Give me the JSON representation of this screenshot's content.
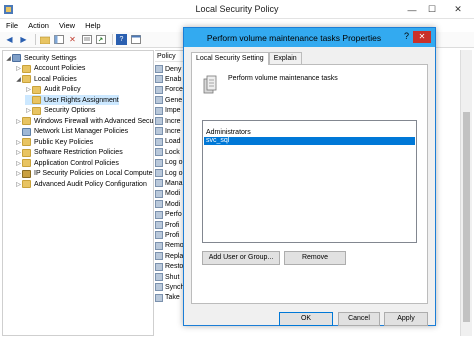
{
  "window": {
    "title": "Local Security Policy"
  },
  "menubar": {
    "items": [
      "File",
      "Action",
      "View",
      "Help"
    ]
  },
  "toolbar": {
    "buttons": [
      "back-icon",
      "forward-icon",
      "up-folder-icon",
      "show-hide-tree-icon",
      "delete-icon",
      "properties-icon",
      "export-icon",
      "help-icon",
      "console-icon"
    ]
  },
  "tree": {
    "items": [
      {
        "label": "Security Settings",
        "level": 0,
        "expander": "◢",
        "icon": "shield"
      },
      {
        "label": "Account Policies",
        "level": 1,
        "expander": "▷",
        "icon": "folder"
      },
      {
        "label": "Local Policies",
        "level": 1,
        "expander": "◢",
        "icon": "folder"
      },
      {
        "label": "Audit Policy",
        "level": 2,
        "expander": "▷",
        "icon": "folder"
      },
      {
        "label": "User Rights Assignment",
        "level": 2,
        "expander": "",
        "icon": "folder",
        "selected": true
      },
      {
        "label": "Security Options",
        "level": 2,
        "expander": "▷",
        "icon": "folder"
      },
      {
        "label": "Windows Firewall with Advanced Secu",
        "level": 1,
        "expander": "▷",
        "icon": "folder"
      },
      {
        "label": "Network List Manager Policies",
        "level": 1,
        "expander": "",
        "icon": "net"
      },
      {
        "label": "Public Key Policies",
        "level": 1,
        "expander": "▷",
        "icon": "folder"
      },
      {
        "label": "Software Restriction Policies",
        "level": 1,
        "expander": "▷",
        "icon": "folder"
      },
      {
        "label": "Application Control Policies",
        "level": 1,
        "expander": "▷",
        "icon": "folder"
      },
      {
        "label": "IP Security Policies on Local Compute",
        "level": 1,
        "expander": "▷",
        "icon": "ipsec"
      },
      {
        "label": "Advanced Audit Policy Configuration",
        "level": 1,
        "expander": "▷",
        "icon": "folder"
      }
    ]
  },
  "policy_column": {
    "header": "Policy",
    "rows": [
      "Deny",
      "Enab",
      "Force",
      "Gene",
      "Impe",
      "Incre",
      "Incre",
      "Load",
      "Lock",
      "Log o",
      "Log o",
      "Mana",
      "Modi",
      "Modi",
      "Perfo",
      "Profi",
      "Profi",
      "Remo",
      "Repla",
      "Resto",
      "Shut",
      "Synch",
      "Take"
    ]
  },
  "dialog": {
    "title": "Perform volume maintenance tasks Properties",
    "help": "?",
    "close": "✕",
    "tabs": [
      "Local Security Setting",
      "Explain"
    ],
    "policy_name": "Perform volume maintenance tasks",
    "accounts": [
      "Administrators",
      "svc_sql"
    ],
    "selected_account": "svc_sql",
    "add_button": "Add User or Group...",
    "remove_button": "Remove",
    "ok": "OK",
    "cancel": "Cancel",
    "apply": "Apply"
  },
  "colors": {
    "accent": "#0078d7",
    "dialog_titlebar": "#33aaf0",
    "close_button": "#c9312a"
  }
}
